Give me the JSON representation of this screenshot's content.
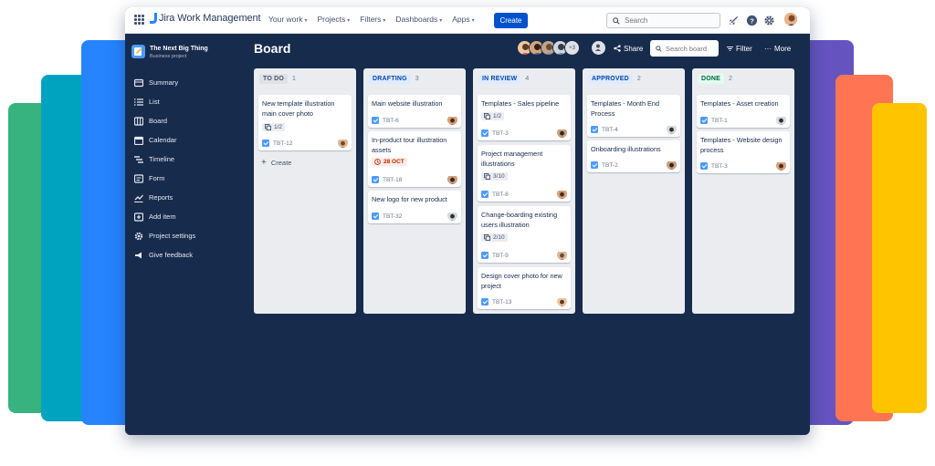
{
  "background_cards": [
    {
      "name": "green",
      "color": "#36b37e"
    },
    {
      "name": "teal",
      "color": "#00a3bf"
    },
    {
      "name": "blue",
      "color": "#2684ff"
    },
    {
      "name": "purple",
      "color": "#6554c0"
    },
    {
      "name": "orange",
      "color": "#ff7452"
    },
    {
      "name": "yellow",
      "color": "#ffc400"
    }
  ],
  "topbar": {
    "product": "Jira Work Management",
    "nav": [
      "Your work",
      "Projects",
      "Filters",
      "Dashboards",
      "Apps"
    ],
    "create_label": "Create",
    "search_placeholder": "Search",
    "icons": [
      "notifications-icon",
      "help-icon",
      "settings-icon"
    ]
  },
  "sidebar": {
    "project_name": "The Next Big Thing",
    "project_type": "Business project",
    "items": [
      {
        "label": "Summary",
        "icon": "summary-icon"
      },
      {
        "label": "List",
        "icon": "list-icon"
      },
      {
        "label": "Board",
        "icon": "board-icon"
      },
      {
        "label": "Calendar",
        "icon": "calendar-icon"
      },
      {
        "label": "Timeline",
        "icon": "timeline-icon"
      },
      {
        "label": "Form",
        "icon": "form-icon"
      },
      {
        "label": "Reports",
        "icon": "reports-icon"
      },
      {
        "label": "Add item",
        "icon": "add-item-icon"
      },
      {
        "label": "Project settings",
        "icon": "settings-icon"
      },
      {
        "label": "Give feedback",
        "icon": "feedback-icon"
      }
    ]
  },
  "board": {
    "title": "Board",
    "extra_members": "+3",
    "share_label": "Share",
    "search_placeholder": "Search board",
    "filter_label": "Filter",
    "more_label": "More",
    "columns": [
      {
        "name": "TO DO",
        "count": "1",
        "color": "#dfe1e6",
        "text_color": "#42526e",
        "create_label": "Create",
        "cards": [
          {
            "title": "New template illustration main cover photo",
            "subtasks": "1/2",
            "key": "TBT-12"
          }
        ]
      },
      {
        "name": "DRAFTING",
        "count": "3",
        "color": "#deebff",
        "text_color": "#0747a6",
        "cards": [
          {
            "title": "Main website illustration",
            "key": "TBT-6"
          },
          {
            "title": "In-product tour illustration assets",
            "due": "28 OCT",
            "key": "TBT-18"
          },
          {
            "title": "New logo for new product",
            "key": "TBT-32"
          }
        ]
      },
      {
        "name": "IN REVIEW",
        "count": "4",
        "color": "#deebff",
        "text_color": "#0747a6",
        "cards": [
          {
            "title": "Templates - Sales pipeline",
            "subtasks": "1/2",
            "key": "TBT-3"
          },
          {
            "title": "Project management illustrations",
            "subtasks": "3/10",
            "key": "TBT-8"
          },
          {
            "title": "Change-boarding existing users illustration",
            "subtasks": "2/10",
            "key": "TBT-9"
          },
          {
            "title": "Design cover photo for new project",
            "key": "TBT-13"
          }
        ]
      },
      {
        "name": "APPROVED",
        "count": "2",
        "color": "#deebff",
        "text_color": "#0747a6",
        "cards": [
          {
            "title": "Templates - Month End Process",
            "key": "TBT-4"
          },
          {
            "title": "Onboarding illustrations",
            "key": "TBT-2"
          }
        ]
      },
      {
        "name": "DONE",
        "count": "2",
        "color": "#e3fcef",
        "text_color": "#006644",
        "cards": [
          {
            "title": "Templates - Asset creation",
            "key": "TBT-1"
          },
          {
            "title": "Templates - Website design process",
            "key": "TBT-3"
          }
        ]
      }
    ]
  }
}
